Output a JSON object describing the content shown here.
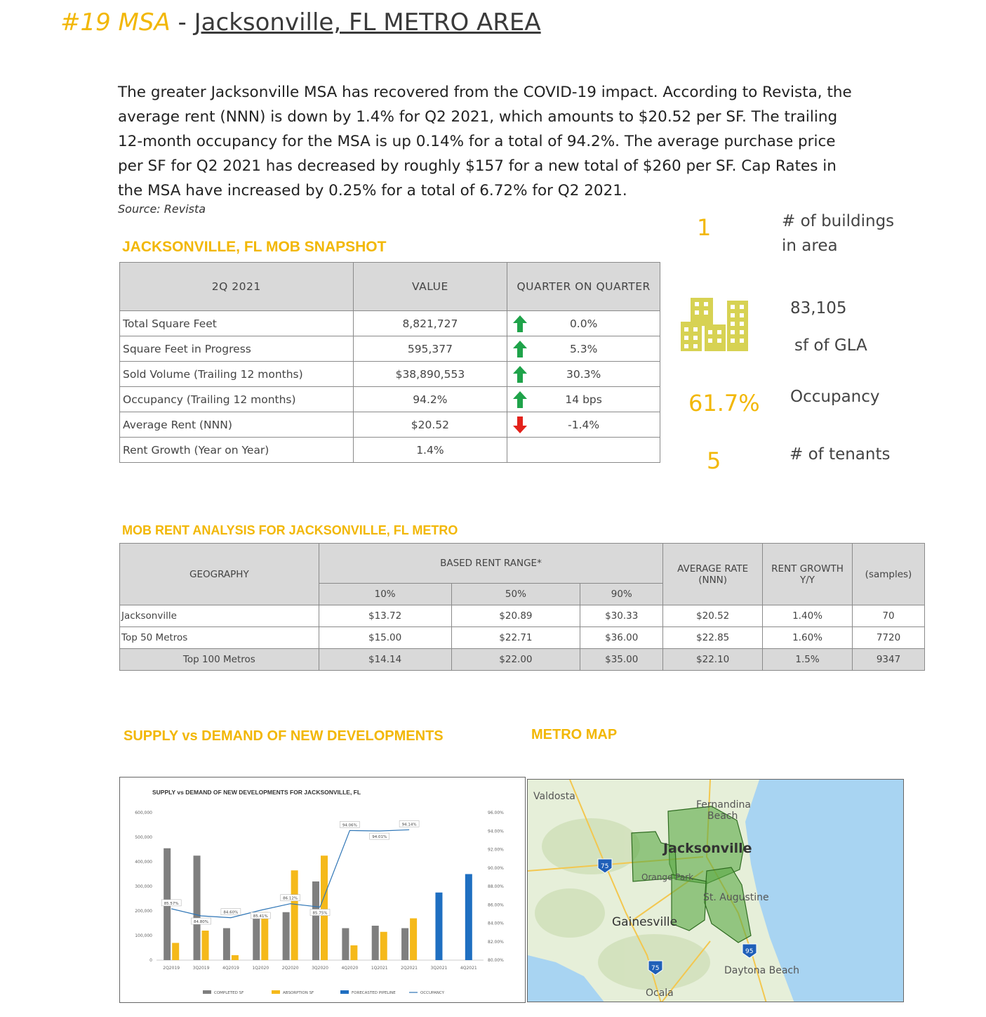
{
  "header": {
    "rank": "#19 MSA",
    "dash": " - ",
    "area": "Jacksonville, FL METRO AREA"
  },
  "intro": {
    "paragraph": "The greater Jacksonville MSA has recovered from the COVID-19 impact. According to Revista, the average rent (NNN) is down by 1.4% for Q2 2021, which amounts to $20.52 per SF. The trailing 12-month occupancy for the MSA is up 0.14% for a total of 94.2%. The average purchase price per SF for Q2 2021 has decreased by roughly $157 for a new total of $260 per SF. Cap Rates in the MSA have increased by 0.25% for a total of 6.72% for Q2 2021.",
    "source": "Source: Revista"
  },
  "snapshot": {
    "title": "JACKSONVILLE, FL MOB SNAPSHOT",
    "headers": [
      "2Q 2021",
      "VALUE",
      "QUARTER ON QUARTER"
    ],
    "rows": [
      {
        "label": "Total Square Feet",
        "value": "8,821,727",
        "trend": "up",
        "qoq": "0.0%"
      },
      {
        "label": "Square Feet in Progress",
        "value": "595,377",
        "trend": "up",
        "qoq": "5.3%"
      },
      {
        "label": "Sold Volume (Trailing 12 months)",
        "value": "$38,890,553",
        "trend": "up",
        "qoq": "30.3%"
      },
      {
        "label": "Occupancy (Trailing 12 months)",
        "value": "94.2%",
        "trend": "up",
        "qoq": "14 bps"
      },
      {
        "label": "Average Rent (NNN)",
        "value": "$20.52",
        "trend": "down",
        "qoq": "-1.4%"
      },
      {
        "label": "Rent Growth (Year on Year)",
        "value": "1.4%",
        "trend": "",
        "qoq": ""
      }
    ],
    "colors": {
      "up": "#1fa34a",
      "down": "#e3221b"
    }
  },
  "stats": {
    "buildings_value": "1",
    "buildings_label_1": "# of buildings",
    "buildings_label_2": "in area",
    "gla_value": "83,105",
    "gla_label": "sf of GLA",
    "occupancy_value": "61.7%",
    "occupancy_label": "Occupancy",
    "tenants_value": "5",
    "tenants_label": "# of tenants",
    "icon": "buildings-icon"
  },
  "rent_analysis": {
    "title": "MOB RENT ANALYSIS FOR JACKSONVILLE, FL METRO",
    "col_geography": "GEOGRAPHY",
    "col_range": "BASED RENT RANGE*",
    "col_avg_1": "AVERAGE RATE",
    "col_avg_2": "(NNN)",
    "col_growth_1": "RENT GROWTH",
    "col_growth_2": "Y/Y",
    "col_samples": "(samples)",
    "percentiles": [
      "10%",
      "50%",
      "90%"
    ],
    "rows": [
      {
        "geo": "Jacksonville",
        "p10": "$13.72",
        "p50": "$20.89",
        "p90": "$30.33",
        "avg": "$20.52",
        "growth": "1.40%",
        "samples": "70"
      },
      {
        "geo": "Top 50 Metros",
        "p10": "$15.00",
        "p50": "$22.71",
        "p90": "$36.00",
        "avg": "$22.85",
        "growth": "1.60%",
        "samples": "7720"
      },
      {
        "geo": "Top 100 Metros",
        "p10": "$14.14",
        "p50": "$22.00",
        "p90": "$35.00",
        "avg": "$22.10",
        "growth": "1.5%",
        "samples": "9347"
      }
    ]
  },
  "supply_demand": {
    "section_title": "SUPPLY vs DEMAND OF NEW DEVELOPMENTS"
  },
  "metro_map": {
    "section_title": "METRO MAP",
    "labels": {
      "valdosta": "Valdosta",
      "fernandina_1": "Fernandina",
      "fernandina_2": "Beach",
      "jacksonville": "Jacksonville",
      "orange_park": "Orange Park",
      "st_augustine": "St. Augustine",
      "gainesville": "Gainesville",
      "daytona": "Daytona Beach",
      "ocala": "Ocala",
      "i75": "75",
      "i95": "95"
    },
    "colors": {
      "water": "#a8d4f2",
      "land": "#e6efd9",
      "region": "#5aa845"
    }
  },
  "chart_data": {
    "type": "bar",
    "title": "SUPPLY vs DEMAND OF NEW DEVELOPMENTS FOR JACKSONVILLE, FL",
    "categories": [
      "2Q2019",
      "3Q2019",
      "4Q2019",
      "1Q2020",
      "2Q2020",
      "3Q2020",
      "4Q2020",
      "1Q2021",
      "2Q2021",
      "3Q2021",
      "4Q2021"
    ],
    "ylim": [
      0,
      600000
    ],
    "yticks": [
      "0",
      "100,000",
      "200,000",
      "300,000",
      "400,000",
      "500,000",
      "600,000"
    ],
    "y2lim": [
      80,
      96
    ],
    "y2ticks": [
      "80.00%",
      "82.00%",
      "84.00%",
      "86.00%",
      "88.00%",
      "90.00%",
      "92.00%",
      "94.00%",
      "96.00%"
    ],
    "series": [
      {
        "name": "COMPLETED SF",
        "color": "#7f7f7f",
        "values": [
          455000,
          425000,
          130000,
          175000,
          195000,
          320000,
          130000,
          140000,
          130000,
          null,
          null
        ]
      },
      {
        "name": "ABSORPTION SF",
        "color": "#f5b91a",
        "values": [
          70000,
          120000,
          20000,
          195000,
          365000,
          425000,
          60000,
          115000,
          170000,
          null,
          null
        ]
      },
      {
        "name": "FORECASTED PIPELINE",
        "color": "#1f6fc1",
        "values": [
          null,
          null,
          null,
          null,
          null,
          null,
          null,
          null,
          null,
          275000,
          350000
        ]
      },
      {
        "name": "OCCUPANCY",
        "color": "#2e75b6",
        "values": [
          85.57,
          84.8,
          84.6,
          85.41,
          86.12,
          85.75,
          94.06,
          94.01,
          94.14,
          null,
          null
        ],
        "labels": [
          "85.57%",
          "84.80%",
          "84.60%",
          "85.41%",
          "86.12%",
          "85.75%",
          "94.06%",
          "94.01%",
          "94.14%",
          "",
          ""
        ]
      }
    ]
  }
}
